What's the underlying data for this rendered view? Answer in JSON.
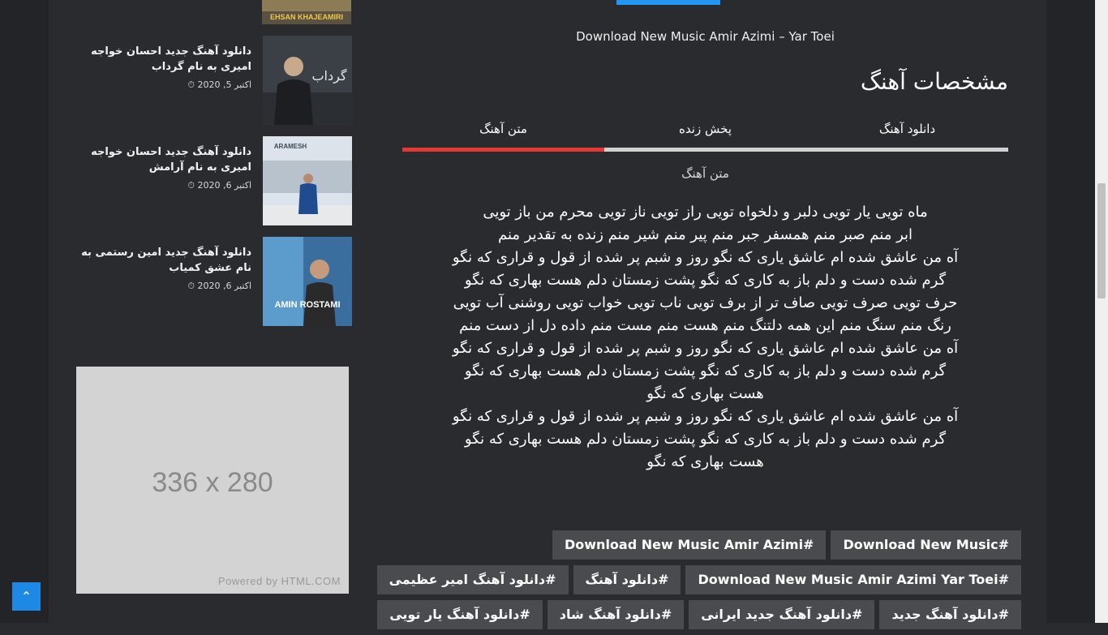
{
  "sidebar": {
    "posts": [
      {
        "title": "دانلود آهنگ جدید احسان خواجه امیری به نام گرداب",
        "date": "اکتبر 5, 2020",
        "cover_text": "گرداب"
      },
      {
        "title": "دانلود آهنگ جدید احسان خواجه امیری به نام آرامش",
        "date": "اکتبر 6, 2020",
        "cover_text": "ARAMESH"
      },
      {
        "title": "دانلود آهنگ جدید امین رستمی به نام عشق کمیاب",
        "date": "اکتبر 6, 2020",
        "cover_text": "AMIN ROSTAMI"
      }
    ],
    "top_thumb_text": "EHSAN KHAJEAMIRI",
    "ad": {
      "size_label": "336 x 280",
      "powered": "Powered by HTML.COM"
    }
  },
  "main": {
    "caption": "Download New Music Amir Azimi – Yar Toei",
    "section_title": "مشخصات آهنگ",
    "tabs": [
      {
        "label": "دانلود آهنگ"
      },
      {
        "label": "پخش زنده"
      },
      {
        "label": "متن آهنگ"
      }
    ],
    "lyrics_title": "متن آهنگ",
    "lyrics": [
      "ماه تویی یار تویی دلبر و دلخواه تویی راز تویی ناز تویی محرم من باز تویی",
      "ابر منم صبر منم همسفر جبر منم پیر منم شیر منم زنده به تقدیر منم",
      "آه من عاشق شده ام عاشق یاری که نگو روز و شبم پر شده از قول و قراری که نگو",
      "گرم شده دست و دلم باز به کاری که نگو پشت زمستان دلم هست بهاری که نگو",
      "حرف تویی صرف تویی صاف تر از برف تویی ناب تویی خواب تویی روشنی آب تویی",
      "رنگ منم سنگ منم این همه دلتنگ منم هست منم مست منم داده دل از دست منم",
      "آه من عاشق شده ام عاشق یاری که نگو روز و شبم پر شده از قول و قراری که نگو",
      "گرم شده دست و دلم باز به کاری که نگو پشت زمستان دلم هست بهاری که نگو",
      "هست بهاری که نگو",
      "آه من عاشق شده ام عاشق یاری که نگو روز و شبم پر شده از قول و قراری که نگو",
      "گرم شده دست و دلم باز به کاری که نگو پشت زمستان دلم هست بهاری که نگو",
      "هست بهاری که نگو"
    ],
    "tags": [
      [
        "#Download New Music",
        "#Download New Music Amir Azimi"
      ],
      [
        "#Download New Music Amir Azimi Yar Toei",
        "#دانلود آهنگ",
        "#دانلود آهنگ امیر عظیمی"
      ],
      [
        "#دانلود آهنگ جدید",
        "#دانلود آهنگ جدید ایرانی",
        "#دانلود آهنگ شاد",
        "#دانلود آهنگ یار تویی"
      ]
    ]
  },
  "back_to_top_icon": "chevron-up-icon",
  "colors": {
    "tab_active": "#e53935",
    "accent": "#2196f3",
    "background": "#2a2b2e"
  }
}
